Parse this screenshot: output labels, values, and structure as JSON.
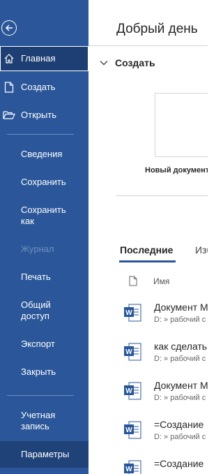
{
  "sidebar": {
    "back_label": "Назад",
    "items": [
      {
        "key": "home",
        "label": "Главная",
        "icon": "home-icon"
      },
      {
        "key": "new",
        "label": "Создать",
        "icon": "new-document-icon"
      },
      {
        "key": "open",
        "label": "Открыть",
        "icon": "open-folder-icon"
      },
      {
        "key": "info",
        "label": "Сведения"
      },
      {
        "key": "save",
        "label": "Сохранить"
      },
      {
        "key": "save_as",
        "label": "Сохранить\nкак"
      },
      {
        "key": "history",
        "label": "Журнал"
      },
      {
        "key": "print",
        "label": "Печать"
      },
      {
        "key": "share",
        "label": "Общий\nдоступ"
      },
      {
        "key": "export",
        "label": "Экспорт"
      },
      {
        "key": "close",
        "label": "Закрыть"
      },
      {
        "key": "account",
        "label": "Учетная\nзапись"
      },
      {
        "key": "options",
        "label": "Параметры"
      }
    ],
    "accent": "#2b579a"
  },
  "main": {
    "greeting": "Добрый день",
    "create_section": {
      "title": "Создать",
      "templates": [
        {
          "label": "Новый документ"
        }
      ]
    },
    "tabs": [
      {
        "label": "Последние",
        "selected": true
      },
      {
        "label": "Изб"
      }
    ],
    "file_list": {
      "column_name": "Имя",
      "files": [
        {
          "name": "Документ M",
          "path": "D: » рабочий с",
          "icon": "word-file-icon"
        },
        {
          "name": "как сделать",
          "path": "D: » рабочий с",
          "icon": "word-file-icon"
        },
        {
          "name": "Документ M",
          "path": "D: » рабочий с",
          "icon": "word-file-icon"
        },
        {
          "name": "=Создание",
          "path": "D: » рабочий с",
          "icon": "word-file-icon"
        },
        {
          "name": "=Создание",
          "path": "",
          "icon": "word-file-icon"
        }
      ]
    }
  }
}
